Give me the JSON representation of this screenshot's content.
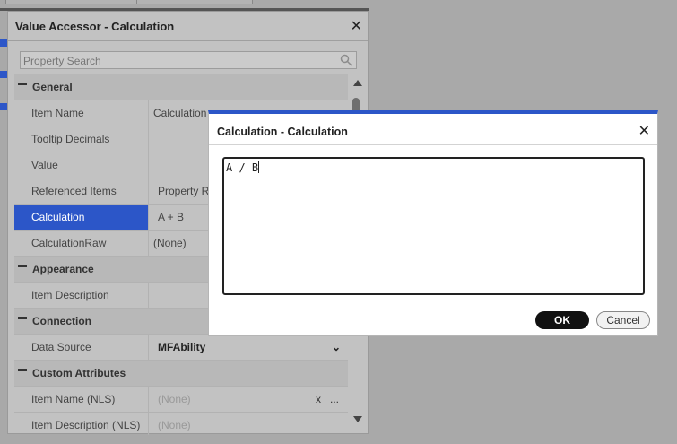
{
  "panel": {
    "title": "Value Accessor - Calculation",
    "search_placeholder": "Property Search",
    "categories": {
      "general": "General",
      "appearance": "Appearance",
      "connection": "Connection",
      "custom": "Custom Attributes"
    },
    "rows": {
      "item_name": {
        "name": "Item Name",
        "value": "Calculation"
      },
      "tooltip": {
        "name": "Tooltip Decimals",
        "value": ""
      },
      "value": {
        "name": "Value",
        "value": ""
      },
      "referenced": {
        "name": "Referenced Items",
        "value": "Property R"
      },
      "calculation": {
        "name": "Calculation",
        "value": "A + B"
      },
      "calcraw": {
        "name": "CalculationRaw",
        "value": "(None)"
      },
      "item_desc": {
        "name": "Item Description",
        "value": ""
      },
      "data_source": {
        "name": "Data Source",
        "value": "MFAbility"
      },
      "item_name_nls": {
        "name": "Item Name (NLS)",
        "value": "(None)"
      },
      "item_desc_nls": {
        "name": "Item Description (NLS)",
        "value": "(None)"
      }
    },
    "x_label": "x",
    "dots_label": "..."
  },
  "dialog": {
    "title": "Calculation - Calculation",
    "expression": "A / B",
    "ok_label": "OK",
    "cancel_label": "Cancel"
  },
  "colors": {
    "accent": "#2c56c8",
    "selected_row": "#2c56c8"
  }
}
